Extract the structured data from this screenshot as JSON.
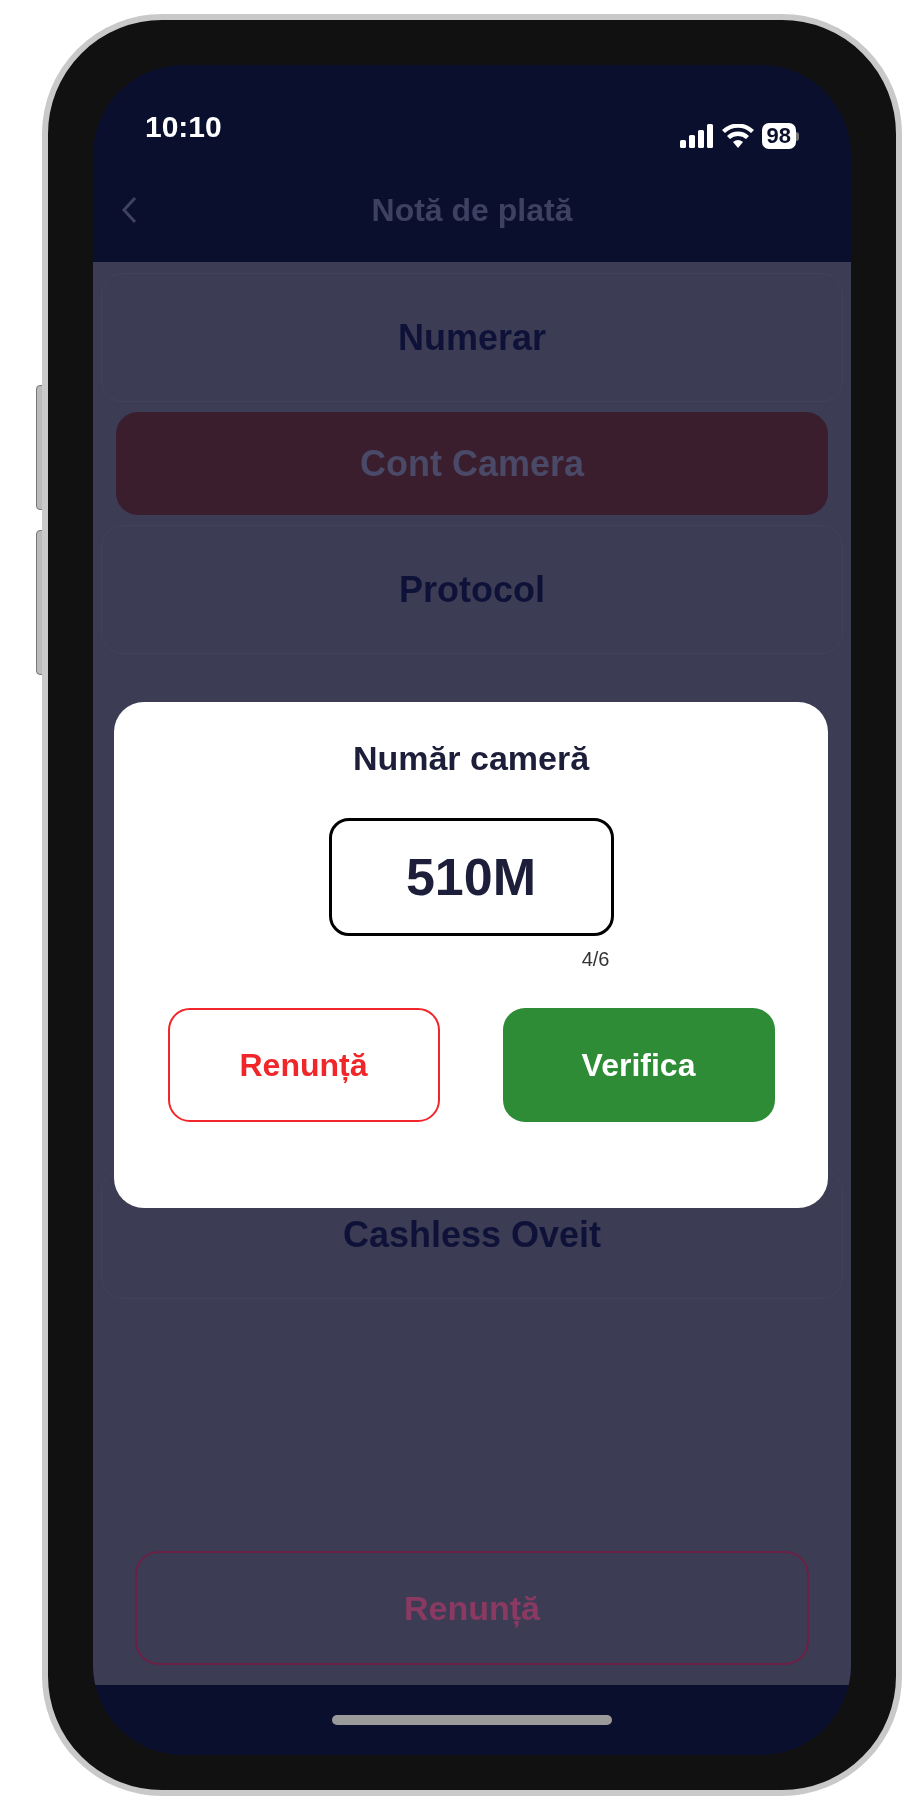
{
  "status_bar": {
    "time": "10:10",
    "battery": "98"
  },
  "nav": {
    "title": "Notă de plată"
  },
  "payment_options": [
    {
      "label": "Numerar",
      "selected": false
    },
    {
      "label": "Cont Camera",
      "selected": true
    },
    {
      "label": "Protocol",
      "selected": false
    },
    {
      "label": "Cashless Oveit",
      "selected": false
    }
  ],
  "cancel_button": "Renunță",
  "dialog": {
    "title": "Număr cameră",
    "value": "510M",
    "counter": "4/6",
    "buttons": [
      {
        "label": "Renunță",
        "kind": "secondary"
      },
      {
        "label": "Verifica",
        "kind": "primary"
      }
    ]
  }
}
